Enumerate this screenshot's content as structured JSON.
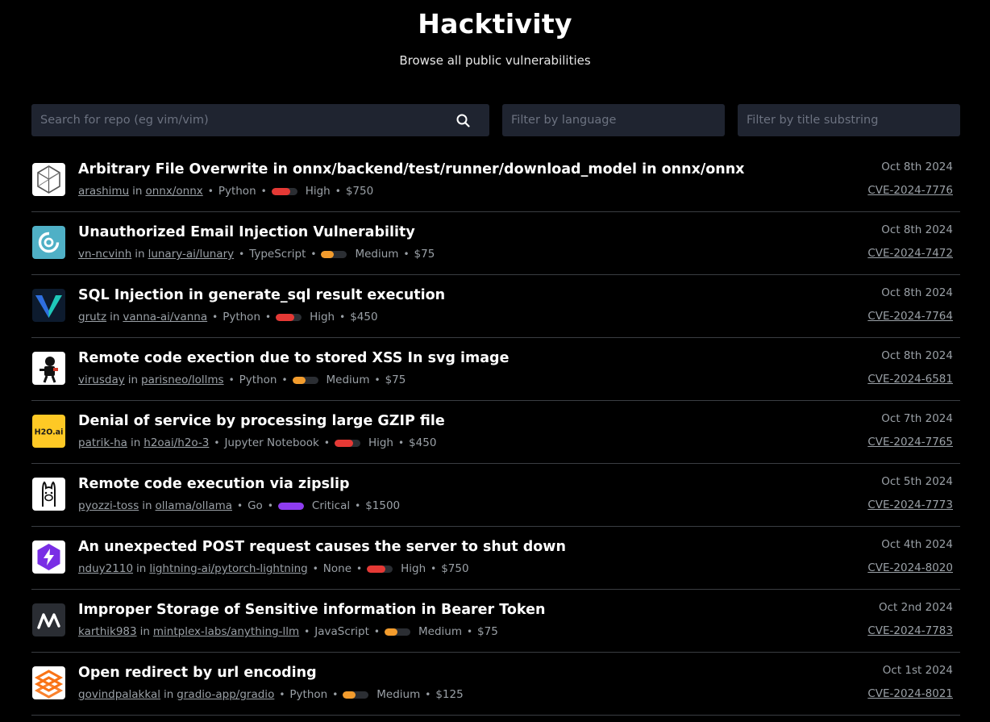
{
  "header": {
    "title": "Hacktivity",
    "subtitle": "Browse all public vulnerabilities"
  },
  "filters": {
    "repo_placeholder": "Search for repo (eg vim/vim)",
    "language_placeholder": "Filter by language",
    "title_placeholder": "Filter by title substring"
  },
  "colors": {
    "background": "#000000",
    "field_background": "#1f2430",
    "divider": "#3a3d42",
    "muted_text": "#9aa0a6",
    "high": "#e53935",
    "medium": "#f39c2d",
    "critical": "#8e3cf0"
  },
  "separators": {
    "in": "in",
    "dot": "•"
  },
  "reports": [
    {
      "logo_icon": "onnx-logo-icon",
      "title": "Arbitrary File Overwrite in onnx/backend/test/runner/download_model in onnx/onnx",
      "user": "arashimu",
      "repo": "onnx/onnx",
      "language": "Python",
      "severity": "High",
      "severity_level": 0.72,
      "severity_color": "#e53935",
      "bounty": "$750",
      "date": "Oct 8th 2024",
      "cve": "CVE-2024-7776"
    },
    {
      "logo_icon": "lunary-logo-icon",
      "title": "Unauthorized Email Injection Vulnerability",
      "user": "vn-ncvinh",
      "repo": "lunary-ai/lunary",
      "language": "TypeScript",
      "severity": "Medium",
      "severity_level": 0.5,
      "severity_color": "#f39c2d",
      "bounty": "$75",
      "date": "Oct 8th 2024",
      "cve": "CVE-2024-7472"
    },
    {
      "logo_icon": "vanna-logo-icon",
      "title": "SQL Injection in generate_sql result execution",
      "user": "grutz",
      "repo": "vanna-ai/vanna",
      "language": "Python",
      "severity": "High",
      "severity_level": 0.72,
      "severity_color": "#e53935",
      "bounty": "$450",
      "date": "Oct 8th 2024",
      "cve": "CVE-2024-7764"
    },
    {
      "logo_icon": "lollms-logo-icon",
      "title": "Remote code exection due to stored XSS In svg image",
      "user": "virusday",
      "repo": "parisneo/lollms",
      "language": "Python",
      "severity": "Medium",
      "severity_level": 0.5,
      "severity_color": "#f39c2d",
      "bounty": "$75",
      "date": "Oct 8th 2024",
      "cve": "CVE-2024-6581"
    },
    {
      "logo_icon": "h2o-logo-icon",
      "logo_text": "H2O.ai",
      "title": "Denial of service by processing large GZIP file",
      "user": "patrik-ha",
      "repo": "h2oai/h2o-3",
      "language": "Jupyter Notebook",
      "severity": "High",
      "severity_level": 0.72,
      "severity_color": "#e53935",
      "bounty": "$450",
      "date": "Oct 7th 2024",
      "cve": "CVE-2024-7765"
    },
    {
      "logo_icon": "ollama-logo-icon",
      "title": "Remote code execution via zipslip",
      "user": "pyozzi-toss",
      "repo": "ollama/ollama",
      "language": "Go",
      "severity": "Critical",
      "severity_level": 1.0,
      "severity_color": "#8e3cf0",
      "bounty": "$1500",
      "date": "Oct 5th 2024",
      "cve": "CVE-2024-7773"
    },
    {
      "logo_icon": "lightning-logo-icon",
      "title": "An unexpected POST request causes the server to shut down",
      "user": "nduy2110",
      "repo": "lightning-ai/pytorch-lightning",
      "language": "None",
      "severity": "High",
      "severity_level": 0.72,
      "severity_color": "#e53935",
      "bounty": "$750",
      "date": "Oct 4th 2024",
      "cve": "CVE-2024-8020"
    },
    {
      "logo_icon": "anything-llm-logo-icon",
      "title": "Improper Storage of Sensitive information in Bearer Token",
      "user": "karthik983",
      "repo": "mintplex-labs/anything-llm",
      "language": "JavaScript",
      "severity": "Medium",
      "severity_level": 0.5,
      "severity_color": "#f39c2d",
      "bounty": "$75",
      "date": "Oct 2nd 2024",
      "cve": "CVE-2024-7783"
    },
    {
      "logo_icon": "gradio-logo-icon",
      "title": "Open redirect by url encoding",
      "user": "govindpalakkal",
      "repo": "gradio-app/gradio",
      "language": "Python",
      "severity": "Medium",
      "severity_level": 0.5,
      "severity_color": "#f39c2d",
      "bounty": "$125",
      "date": "Oct 1st 2024",
      "cve": "CVE-2024-8021"
    }
  ]
}
